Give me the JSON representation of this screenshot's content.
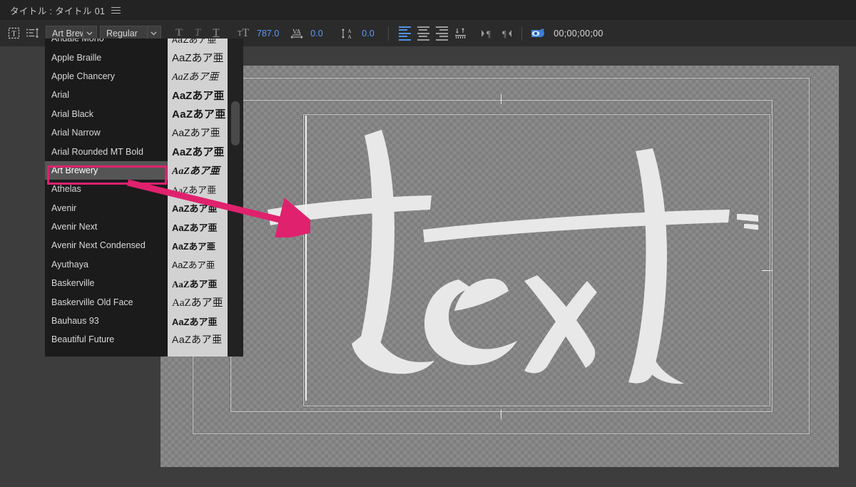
{
  "window": {
    "tab_title": "タイトル : タイトル 01",
    "menu_icon": "hamburger-icon"
  },
  "toolbar": {
    "text_tool_icon": "text-frame-icon",
    "paragraph_tool_icon": "paragraph-spacing-icon",
    "font_family": "Art Brew…",
    "font_style": "Regular",
    "caret_icon": "chevron-down-icon",
    "bold_icon": "bold-T-icon",
    "italic_icon": "italic-T-icon",
    "underline_icon": "underline-T-icon",
    "font_size_icon": "font-size-icon",
    "font_size": "787.0",
    "tracking_icon": "tracking-VA-icon",
    "tracking": "0.0",
    "leading_icon": "leading-A-icon",
    "leading": "0.0",
    "align_left_icon": "align-left-icon",
    "align_center_icon": "align-center-icon",
    "align_right_icon": "align-right-icon",
    "tab_stop_icon": "tab-stop-icon",
    "start_paragraph_icon": "ltr-paragraph-icon",
    "end_paragraph_icon": "rtl-paragraph-icon",
    "eye_icon": "visibility-eye-icon",
    "timecode": "00;00;00;00"
  },
  "font_menu": {
    "preview_sample": "AaZあア亜",
    "selected": "Art Brewery",
    "items": [
      {
        "name": "Andale Mono",
        "preview": "AaZあア亜"
      },
      {
        "name": "Apple Braille",
        "preview": "AaZあア亜"
      },
      {
        "name": "Apple Chancery",
        "preview": "AaZあア亜"
      },
      {
        "name": "Arial",
        "preview": "AaZあア亜"
      },
      {
        "name": "Arial Black",
        "preview": "AaZあア亜"
      },
      {
        "name": "Arial Narrow",
        "preview": "AaZあア亜"
      },
      {
        "name": "Arial Rounded MT Bold",
        "preview": "AaZあア亜"
      },
      {
        "name": "Art Brewery",
        "preview": "AaZあア亜"
      },
      {
        "name": "Athelas",
        "preview": "AaZあア亜"
      },
      {
        "name": "Avenir",
        "preview": "AaZあア亜"
      },
      {
        "name": "Avenir Next",
        "preview": "AaZあア亜"
      },
      {
        "name": "Avenir Next Condensed",
        "preview": "AaZあア亜"
      },
      {
        "name": "Ayuthaya",
        "preview": "AaZあア亜"
      },
      {
        "name": "Baskerville",
        "preview": "AaZあア亜"
      },
      {
        "name": "Baskerville Old Face",
        "preview": "AaZあア亜"
      },
      {
        "name": "Bauhaus 93",
        "preview": "AaZあア亜"
      },
      {
        "name": "Beautiful Future",
        "preview": "AaZあア亜"
      }
    ]
  },
  "canvas": {
    "artwork_text": "text",
    "transparency_grid": true,
    "text_cursor": "text-insertion-caret"
  },
  "annotation": {
    "highlight_color": "#e0216e",
    "arrow_color": "#e0216e",
    "target": "Art Brewery"
  }
}
